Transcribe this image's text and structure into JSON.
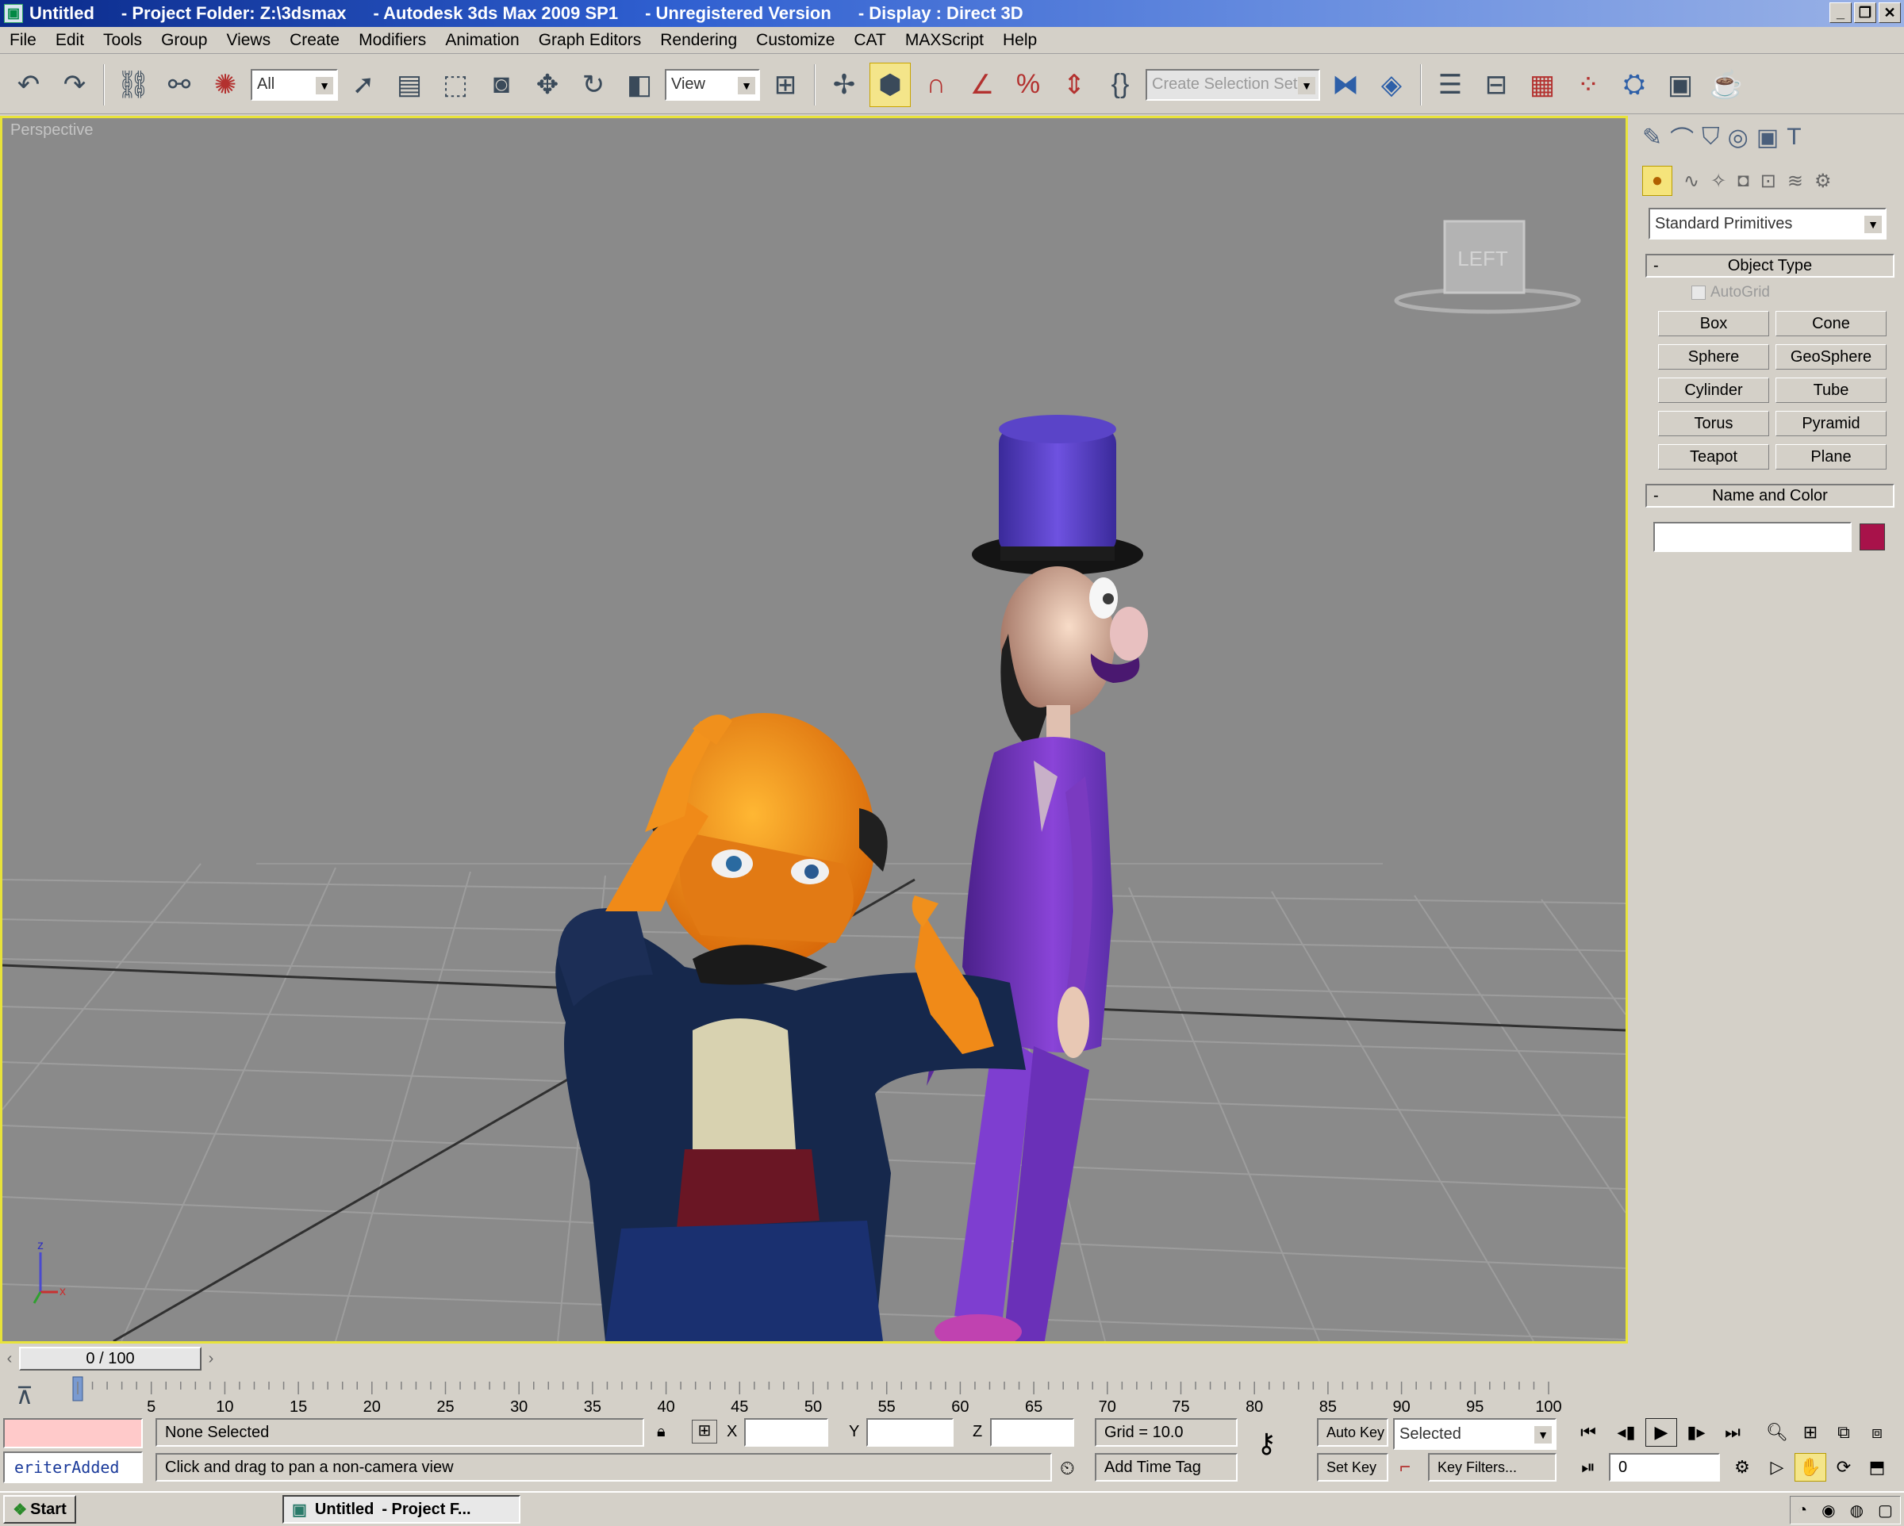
{
  "window": {
    "title_segments": [
      "Untitled",
      "- Project Folder: Z:\\3dsmax",
      "- Autodesk 3ds Max  2009 SP1",
      "- Unregistered Version",
      "- Display : Direct 3D"
    ],
    "controls": [
      "_",
      "❐",
      "✕"
    ]
  },
  "menu": [
    "File",
    "Edit",
    "Tools",
    "Group",
    "Views",
    "Create",
    "Modifiers",
    "Animation",
    "Graph Editors",
    "Rendering",
    "Customize",
    "CAT",
    "MAXScript",
    "Help"
  ],
  "toolbar": {
    "selection_filter": "All",
    "reference_coord": "View",
    "named_selection_placeholder": "Create Selection Set",
    "icons": [
      "undo-icon",
      "redo-icon",
      "link-icon",
      "unlink-icon",
      "bind-spacewarp-icon",
      "select-object-icon",
      "select-by-name-icon",
      "rect-region-icon",
      "window-crossing-icon",
      "move-icon",
      "rotate-icon",
      "scale-icon",
      "pivot-icon",
      "manipulate-icon",
      "keyboard-shortcut-icon",
      "snaps-toggle-icon",
      "angle-snap-icon",
      "percent-snap-icon",
      "spinner-snap-icon",
      "edit-named-selection-icon",
      "mirror-icon",
      "align-icon",
      "layer-manager-icon",
      "curve-editor-icon",
      "schematic-view-icon",
      "material-editor-icon",
      "render-setup-icon",
      "rendered-frame-icon",
      "quick-render-icon"
    ]
  },
  "viewport": {
    "label": "Perspective",
    "viewcube_face": "LEFT",
    "axis_labels": {
      "z": "z",
      "x": "x"
    }
  },
  "command_panel": {
    "tabs": [
      "create-tab",
      "modify-tab",
      "hierarchy-tab",
      "motion-tab",
      "display-tab",
      "utilities-tab"
    ],
    "subtabs": [
      "geometry",
      "shapes",
      "lights",
      "cameras",
      "helpers",
      "space-warps",
      "systems"
    ],
    "category": "Standard Primitives",
    "object_type_title": "Object Type",
    "autogrid_label": "AutoGrid",
    "primitives": [
      "Box",
      "Cone",
      "Sphere",
      "GeoSphere",
      "Cylinder",
      "Tube",
      "Torus",
      "Pyramid",
      "Teapot",
      "Plane"
    ],
    "name_and_color_title": "Name and Color",
    "name_value": "",
    "object_color": "#a8124a"
  },
  "timeline": {
    "slider_label": "0 / 100",
    "current_frame": 0,
    "total_frames": 100,
    "ticks": [
      "5",
      "10",
      "15",
      "20",
      "25",
      "30",
      "35",
      "40",
      "45",
      "50",
      "55",
      "60",
      "65",
      "70",
      "75",
      "80",
      "85",
      "90",
      "95",
      "100"
    ]
  },
  "status": {
    "maxscript_output": "",
    "maxscript_listener": "eriterAdded",
    "selection": "None Selected",
    "prompt": "Click and drag to pan a non-camera view",
    "x_label": "X",
    "y_label": "Y",
    "z_label": "Z",
    "x_value": "",
    "y_value": "",
    "z_value": "",
    "grid": "Grid = 10.0",
    "add_time_tag": "Add Time Tag",
    "auto_key": "Auto Key",
    "set_key": "Set Key",
    "key_mode": "Selected",
    "key_filters": "Key Filters...",
    "frame_field": "0"
  },
  "taskbar": {
    "start_label": "Start",
    "items": [
      {
        "title": "Untitled",
        "subtitle": "- Project F..."
      }
    ]
  },
  "colors": {
    "viewport_border": "#e8e33a",
    "viewport_bg": "#8a8a8a",
    "active_tool": "#f4e58a",
    "title_gradient_start": "#0a2a8a"
  }
}
